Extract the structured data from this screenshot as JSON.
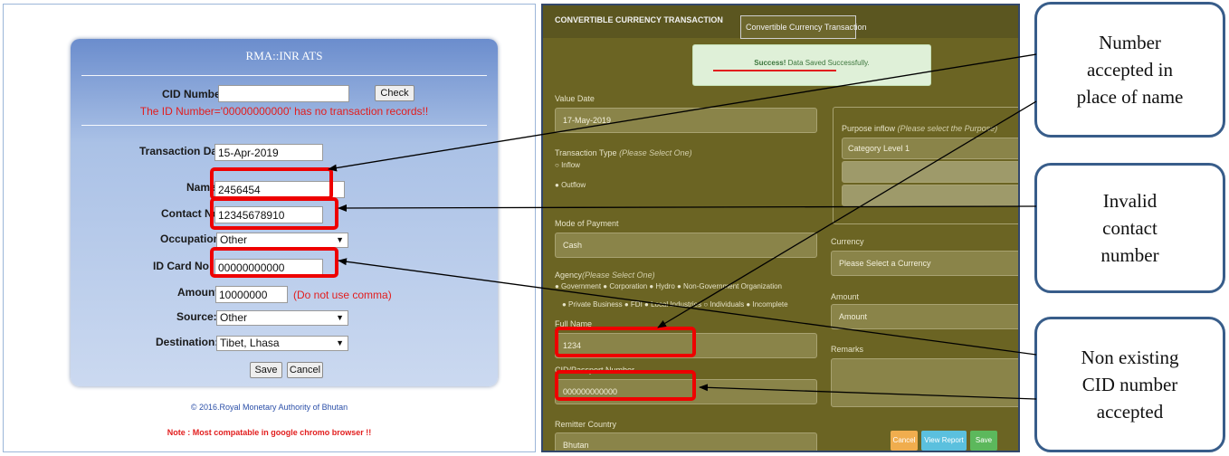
{
  "left_form": {
    "title": "RMA::INR ATS",
    "cid_label": "CID Number:",
    "cid_value": "",
    "check_button": "Check",
    "error_message": "The ID Number='00000000000' has no transaction records!!",
    "transaction_date_label": "Transaction Date:",
    "transaction_date_value": "15-Apr-2019",
    "name_label": "Name",
    "name_value": "2456454",
    "contact_label": "Contact No",
    "contact_value": "12345678910",
    "occupation_label": "Occupation:",
    "occupation_value": "Other",
    "idcard_label": "ID Card No",
    "idcard_value": "00000000000",
    "amount_label": "Amount:",
    "amount_value": "10000000",
    "amount_note": "(Do not use comma)",
    "source_label": "Source:",
    "source_value": "Other",
    "destination_label": "Destination:",
    "destination_value": "Tibet, Lhasa",
    "save_button": "Save",
    "cancel_button": "Cancel",
    "copyright": "© 2016.Royal Monetary Authority of Bhutan",
    "browser_note": "Note : Most compatable in google chromo browser !!"
  },
  "right_form": {
    "header_title": "CONVERTIBLE CURRENCY TRANSACTION",
    "header_box": "Convertible Currency Transaction",
    "success_strong": "Success!",
    "success_text": " Data Saved Successfully.",
    "value_date_label": "Value Date",
    "value_date_value": "17-May-2019",
    "transaction_type_label": "Transaction Type",
    "transaction_type_hint": "(Please Select One)",
    "inflow_option": "Inflow",
    "outflow_option": "Outflow",
    "purpose_label": "Purpose inflow",
    "purpose_hint": "(Please select the Purpose)",
    "category_level": "Category Level 1",
    "mode_label": "Mode of Payment",
    "mode_value": "Cash",
    "currency_label": "Currency",
    "currency_value": "Please Select a Currency",
    "agency_label": "Agency",
    "agency_hint": "(Please Select One)",
    "agency_row1": "● Government  ● Corporation  ● Hydro  ● Non-Government Organization",
    "agency_row2": "● Private Business  ● FDI  ● Local Industries  ○ Individuals  ● Incomplete",
    "amount_label": "Amount",
    "amount_value": "Amount",
    "fullname_label": "Full Name",
    "fullname_value": "1234",
    "remarks_label": "Remarks",
    "cid_label": "CID/Passport Number",
    "cid_value": "000000000000",
    "remitter_label": "Remitter Country",
    "remitter_value": "Bhutan",
    "cancel_button": "Cancel",
    "view_report_button": "View Report",
    "save_button": "Save"
  },
  "callouts": {
    "name": "Number\naccepted in\nplace of name",
    "contact": "Invalid\ncontact\nnumber",
    "cid": "Non existing\nCID number\naccepted"
  },
  "colors": {
    "highlight": "#ee0000",
    "arrow": "#000000",
    "callout_border": "#385d8a",
    "right_background": "#6b6423"
  }
}
